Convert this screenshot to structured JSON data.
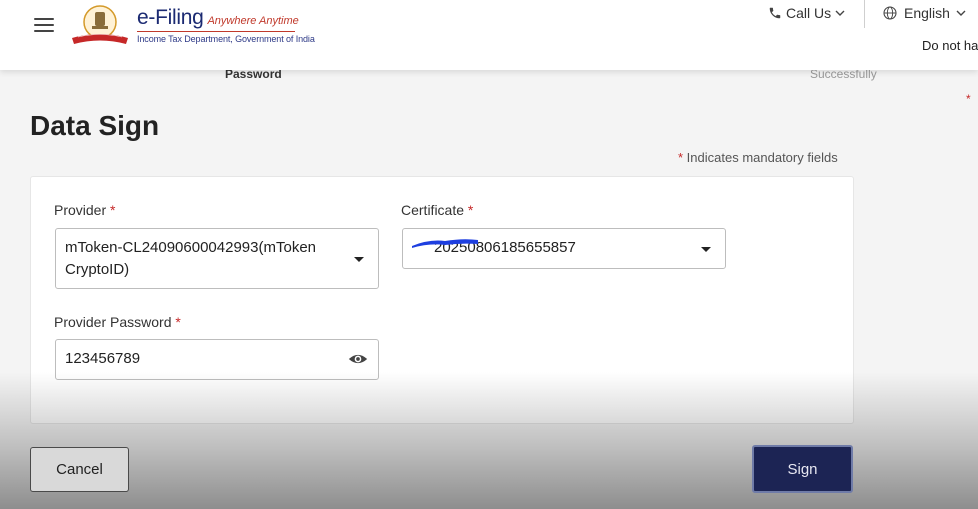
{
  "header": {
    "brand_main": "e-Filing",
    "brand_tagline": "Anywhere Anytime",
    "brand_sub": "Income Tax Department, Government of India",
    "call_us": "Call Us",
    "language": "English",
    "notice_partial": "Do not ha"
  },
  "steps": {
    "left_label": "Password",
    "right_label": "Successfully"
  },
  "page": {
    "title": "Data Sign",
    "mandatory_asterisk": "*",
    "mandatory_note": " Indicates mandatory fields"
  },
  "form": {
    "provider": {
      "label": "Provider",
      "required_mark": "*",
      "value": "mToken-CL24090600042993(mToken CryptoID)"
    },
    "certificate": {
      "label": "Certificate",
      "required_mark": "*",
      "value": "20250806185655857"
    },
    "provider_password": {
      "label": "Provider Password",
      "required_mark": "*",
      "value": "123456789"
    }
  },
  "actions": {
    "cancel_label": "Cancel",
    "sign_label": "Sign"
  },
  "colors": {
    "primary": "#1c2454",
    "required": "#c62828",
    "brand_blue": "#1b2a72",
    "redaction": "#1e3fe0"
  },
  "icons": {
    "menu": "hamburger-icon",
    "phone": "phone-icon",
    "globe": "globe-icon",
    "dropdown": "chevron-down-icon",
    "password_visibility": "eye-icon"
  }
}
